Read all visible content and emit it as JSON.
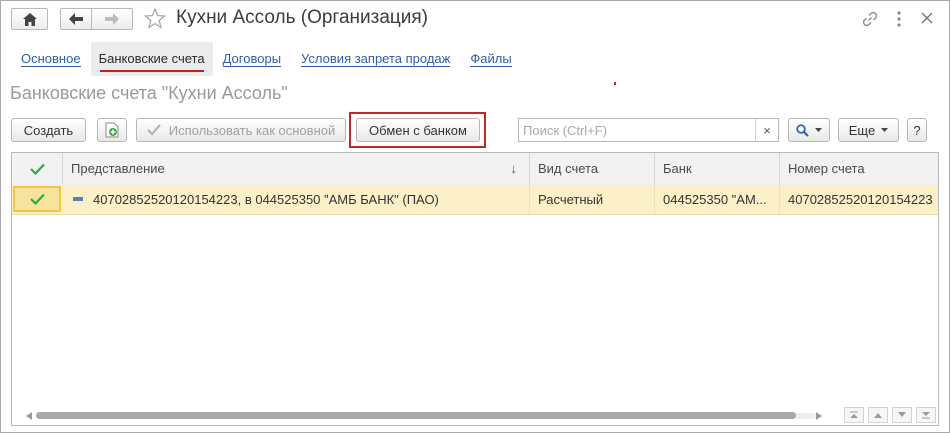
{
  "window": {
    "title": "Кухни Ассоль (Организация)"
  },
  "tabs": [
    {
      "label": "Основное",
      "active": false
    },
    {
      "label": "Банковские счета",
      "active": true
    },
    {
      "label": "Договоры",
      "active": false
    },
    {
      "label": "Условия запрета продаж",
      "active": false
    },
    {
      "label": "Файлы",
      "active": false
    }
  ],
  "subtitle": "Банковские счета \"Кухни Ассоль\"",
  "toolbar": {
    "create_label": "Создать",
    "use_as_main_label": "Использовать как основной",
    "exchange_label": "Обмен с банком",
    "search_placeholder": "Поиск (Ctrl+F)",
    "search_value": "",
    "clear_label": "×",
    "more_label": "Еще",
    "help_label": "?"
  },
  "table": {
    "columns": [
      "Представление",
      "Вид счета",
      "Банк",
      "Номер счета"
    ],
    "sort_indicator": "↓",
    "rows": [
      {
        "representation": "40702852520120154223, в 044525350 \"АМБ БАНК\" (ПАО)",
        "account_type": "Расчетный",
        "bank": "044525350 \"АМ...",
        "account_number": "40702852520120154223"
      }
    ]
  },
  "colors": {
    "accent_red": "#c0282c",
    "link_blue": "#2e5fa8",
    "row_selected": "#fbf0c8",
    "check_green": "#2bab3f"
  },
  "icons": {
    "home": "home-icon",
    "back": "arrow-left-icon",
    "forward": "arrow-right-icon",
    "favorite": "star-icon",
    "link": "link-icon",
    "menu": "more-vertical-icon",
    "close": "close-icon"
  }
}
